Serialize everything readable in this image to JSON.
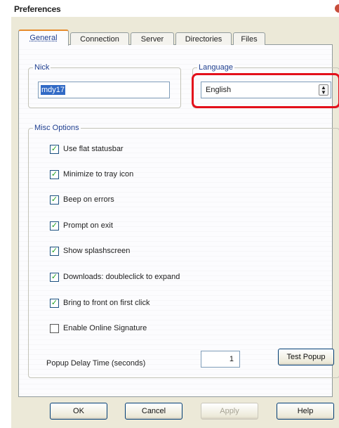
{
  "window": {
    "title": "Preferences"
  },
  "tabs": [
    {
      "label": "General",
      "active": true
    },
    {
      "label": "Connection",
      "active": false
    },
    {
      "label": "Server",
      "active": false
    },
    {
      "label": "Directories",
      "active": false
    },
    {
      "label": "Files",
      "active": false
    }
  ],
  "nick": {
    "legend": "Nick",
    "value": "mdy17"
  },
  "language": {
    "legend": "Language",
    "selected": "English"
  },
  "misc": {
    "legend": "Misc Options",
    "options": [
      {
        "label": "Use flat statusbar",
        "checked": true
      },
      {
        "label": "Minimize to tray icon",
        "checked": true
      },
      {
        "label": "Beep on errors",
        "checked": true
      },
      {
        "label": "Prompt on exit",
        "checked": true
      },
      {
        "label": "Show splashscreen",
        "checked": true
      },
      {
        "label": "Downloads: doubleclick to expand",
        "checked": true
      },
      {
        "label": "Bring to front on first click",
        "checked": true
      },
      {
        "label": "Enable Online Signature",
        "checked": false
      }
    ],
    "popup_label": "Popup Delay Time (seconds)",
    "popup_value": "1",
    "test_label": "Test Popup"
  },
  "buttons": {
    "ok": "OK",
    "cancel": "Cancel",
    "apply": "Apply",
    "help": "Help"
  },
  "colors": {
    "highlight": "#e3101b",
    "check": "#21a121",
    "accent_tab": "#e68b2c"
  }
}
